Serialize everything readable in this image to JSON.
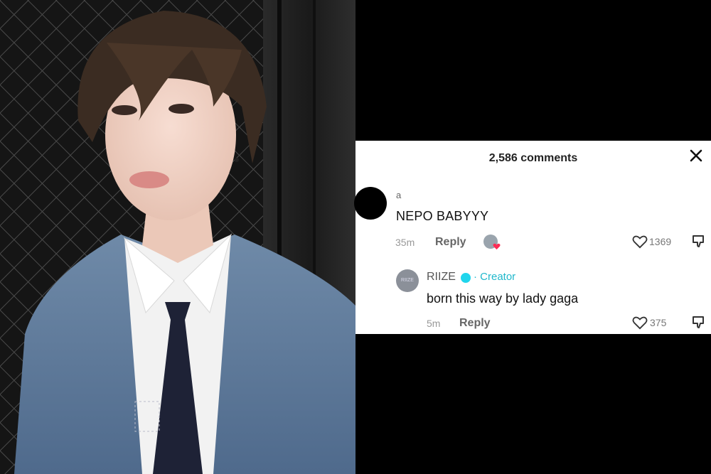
{
  "header": {
    "comment_count": "2,586 comments",
    "close_icon": "close-icon"
  },
  "comments": [
    {
      "username": "a",
      "text": "NEPO BABYYY",
      "time": "35m",
      "reply_label": "Reply",
      "likes": "1369",
      "liked_by_creator": true
    },
    {
      "username": "RIIZE",
      "verified": true,
      "badge": "· Creator",
      "text": "born this way by lady gaga",
      "time": "5m",
      "reply_label": "Reply",
      "likes": "375"
    }
  ],
  "colors": {
    "creator_accent": "#20b8cc",
    "heart_red": "#fe2c55"
  }
}
